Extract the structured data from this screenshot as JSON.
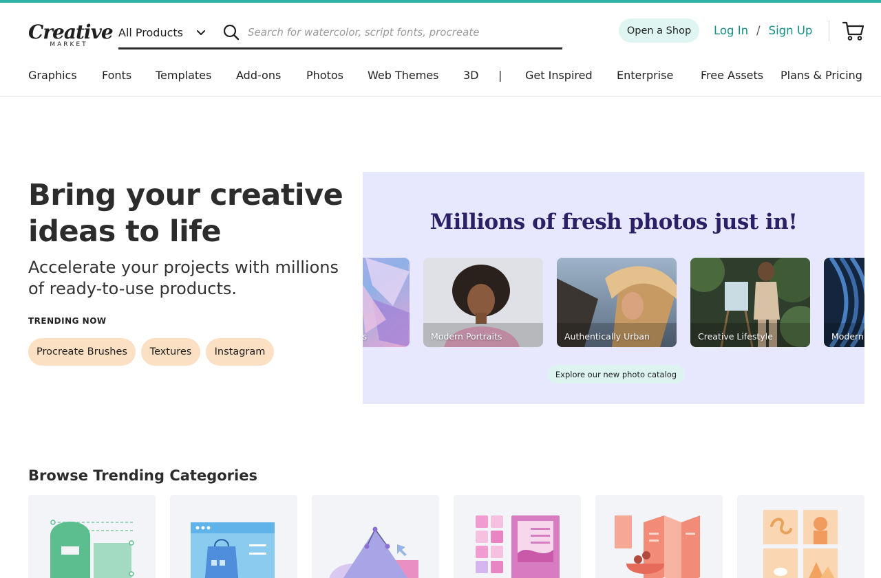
{
  "brand": {
    "logo_word": "Creative",
    "logo_sub": "MARKET",
    "accent": "#2fb0a8",
    "link_color": "#168f86"
  },
  "header": {
    "products_label": "All Products",
    "search_placeholder": "Search for watercolor, script fonts, procreate",
    "open_shop": "Open a Shop",
    "login": "Log In",
    "separator": "/",
    "signup": "Sign Up"
  },
  "nav": {
    "items": [
      "Graphics",
      "Fonts",
      "Templates",
      "Add-ons",
      "Photos",
      "Web Themes",
      "3D",
      "|",
      "Get Inspired",
      "Enterprise",
      "Free Assets",
      "Plans & Pricing"
    ]
  },
  "hero": {
    "title": "Bring your creative ideas to life",
    "subtitle": "Accelerate your projects with millions of ready-to-use products.",
    "trending_label": "TRENDING NOW",
    "chips": [
      "Procreate Brushes",
      "Textures",
      "Instagram"
    ],
    "chip_color": "#fbe0c3"
  },
  "promo": {
    "title": "Millions of fresh photos just in!",
    "cards": [
      "s",
      "Modern Portraits",
      "Authentically Urban",
      "Creative Lifestyle",
      "Modern"
    ],
    "explore": "Explore our new photo catalog",
    "bg_color": "#e7e7fd",
    "title_color": "#2b1f66"
  },
  "browse": {
    "title": "Browse Trending Categories"
  },
  "icons": [
    "chevron-down-icon",
    "search-icon",
    "cart-icon"
  ]
}
